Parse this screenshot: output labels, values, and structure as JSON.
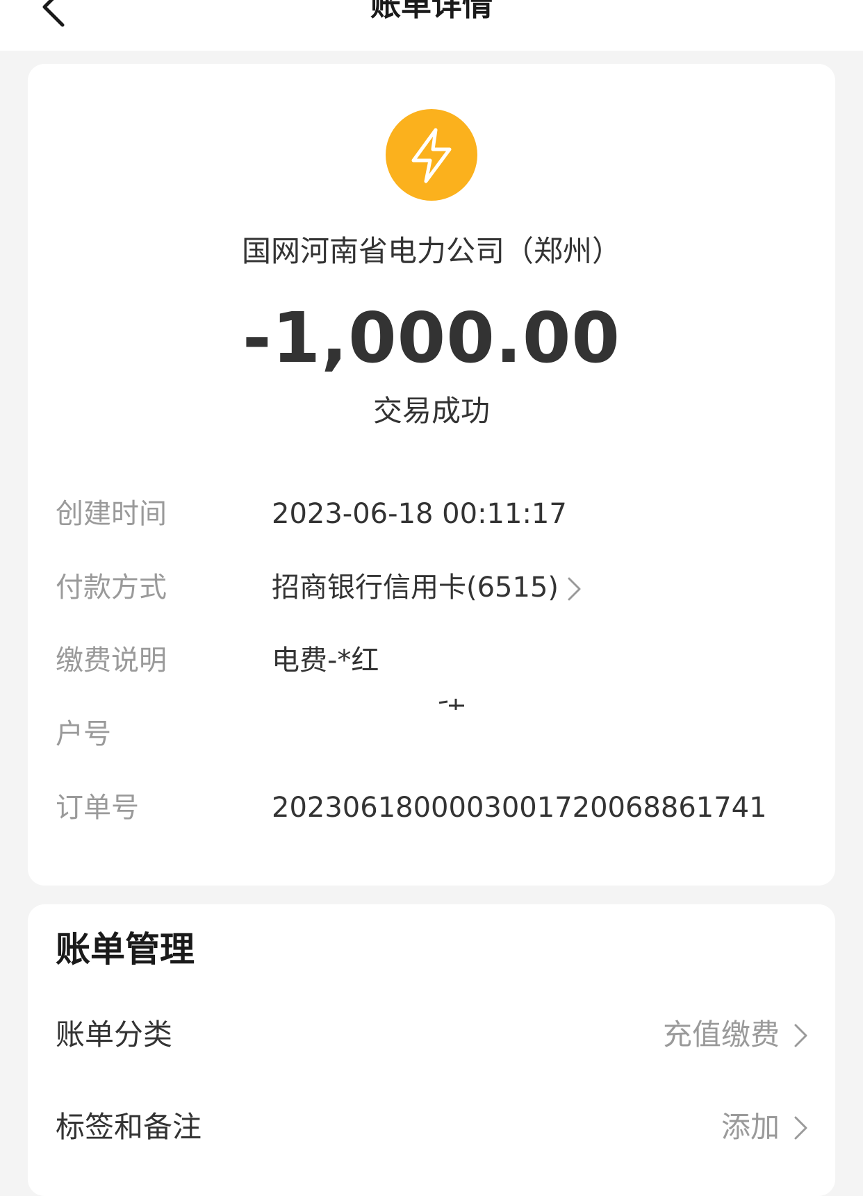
{
  "header": {
    "title": "账单详情",
    "back_icon": "chevron-left-icon"
  },
  "merchant": {
    "icon": "lightning-bolt-icon",
    "icon_color": "#fbb11d",
    "name": "国网河南省电力公司（郑州）"
  },
  "transaction": {
    "amount": "-1,000.00",
    "status": "交易成功"
  },
  "details": [
    {
      "label": "创建时间",
      "value": "2023-06-18 00:11:17"
    },
    {
      "label": "付款方式",
      "value": "招商银行信用卡(6515)"
    },
    {
      "label": "缴费说明",
      "value": "电费-*红"
    },
    {
      "label": "户号",
      "value": ""
    },
    {
      "label": "订单号",
      "value": "2023061800003001720068861741"
    }
  ],
  "manage": {
    "title": "账单管理",
    "rows": [
      {
        "label": "账单分类",
        "value": "充值缴费"
      },
      {
        "label": "标签和备注",
        "value": "添加"
      }
    ]
  }
}
